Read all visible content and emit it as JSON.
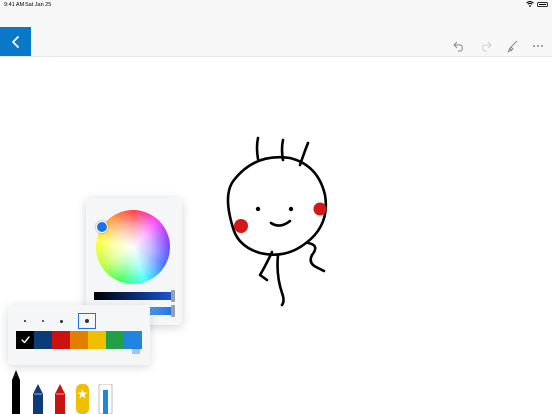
{
  "status_bar": {
    "time": "9:41 AM",
    "date": "Sat Jan 25"
  },
  "toolbar": {
    "back_icon": "chevron-left-icon",
    "undo_icon": "undo-icon",
    "redo_icon": "redo-icon",
    "eraser_icon": "eraser-icon",
    "more_icon": "more-icon",
    "accent_color": "#0a78c8"
  },
  "color_picker": {
    "selected_color": "#1a73e8",
    "brightness": 1.0,
    "opacity": 1.0
  },
  "palette": {
    "brush_sizes": [
      1,
      2,
      3,
      4
    ],
    "selected_size_index": 3,
    "swatches": [
      "#000000",
      "#0d3b78",
      "#cc1111",
      "#e07f00",
      "#f0c000",
      "#23a045",
      "#1f86e0"
    ],
    "selected_swatch_index": 0,
    "more_icon": "menu-lines-icon"
  },
  "pens": [
    {
      "name": "pen-black",
      "color": "#000000"
    },
    {
      "name": "pen-navy",
      "color": "#0d3b78"
    },
    {
      "name": "pen-red",
      "color": "#cc1111"
    },
    {
      "name": "highlighter-yellow",
      "color": "#f0c000"
    },
    {
      "name": "ruler-tool",
      "color": "#ffffff"
    }
  ]
}
